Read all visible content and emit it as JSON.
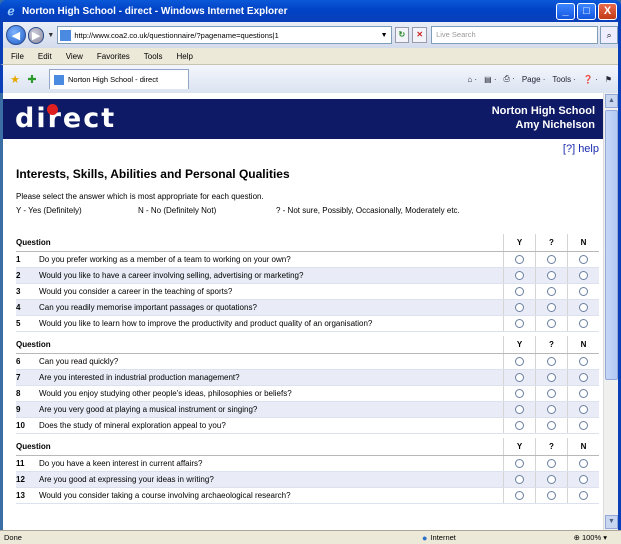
{
  "window": {
    "title": "Norton High School - direct - Windows Internet Explorer",
    "minimize": "_",
    "maximize": "□",
    "close": "X"
  },
  "address": {
    "url": "http://www.coa2.co.uk/questionnaire/?pagename=questions|1",
    "search_placeholder": "Live Search"
  },
  "menu": [
    "File",
    "Edit",
    "View",
    "Favorites",
    "Tools",
    "Help"
  ],
  "tab": {
    "label": "Norton High School - direct"
  },
  "commands": [
    "⌂ ·",
    "▤ ·",
    "⎙ ·",
    "Page ·",
    "Tools ·",
    "❓ ·",
    "⚑"
  ],
  "banner": {
    "logo": "direct",
    "school": "Norton High School",
    "student": "Amy Nichelson"
  },
  "help": "[?] help",
  "heading": "Interests, Skills, Abilities and Personal Qualities",
  "instructions": "Please select the answer which is most appropriate for each question.",
  "legend": {
    "y": "Y - Yes (Definitely)",
    "n": "N - No (Definitely Not)",
    "q": "? - Not sure, Possibly, Occasionally, Moderately etc."
  },
  "table": {
    "col_question": "Question",
    "col_y": "Y",
    "col_q": "?",
    "col_n": "N"
  },
  "groups": [
    {
      "questions": [
        {
          "num": "1",
          "text": "Do you prefer working as a member of a team to working on your own?"
        },
        {
          "num": "2",
          "text": "Would you like to have a career involving selling, advertising or marketing?"
        },
        {
          "num": "3",
          "text": "Would you consider a career in the teaching of sports?"
        },
        {
          "num": "4",
          "text": "Can you readily memorise important passages or quotations?"
        },
        {
          "num": "5",
          "text": "Would you like to learn how to improve the productivity and product quality of an organisation?"
        }
      ]
    },
    {
      "questions": [
        {
          "num": "6",
          "text": "Can you read quickly?"
        },
        {
          "num": "7",
          "text": "Are you interested in industrial production management?"
        },
        {
          "num": "8",
          "text": "Would you enjoy studying other people's ideas, philosophies or beliefs?"
        },
        {
          "num": "9",
          "text": "Are you very good at playing a musical instrument or singing?"
        },
        {
          "num": "10",
          "text": "Does the study of mineral exploration appeal to you?"
        }
      ]
    },
    {
      "questions": [
        {
          "num": "11",
          "text": "Do you have a keen interest in current affairs?"
        },
        {
          "num": "12",
          "text": "Are you good at expressing your ideas in writing?"
        },
        {
          "num": "13",
          "text": "Would you consider taking a course involving archaeological research?"
        }
      ]
    }
  ],
  "status": {
    "text": "Done",
    "zone": "Internet",
    "zoom": "100%"
  },
  "icons": {
    "back": "back-arrow-icon",
    "forward": "forward-arrow-icon",
    "refresh": "refresh-icon",
    "stop": "stop-icon",
    "search": "search-icon",
    "favorites": "star-icon",
    "add_favorite": "add-favorite-icon",
    "internet": "globe-icon"
  }
}
